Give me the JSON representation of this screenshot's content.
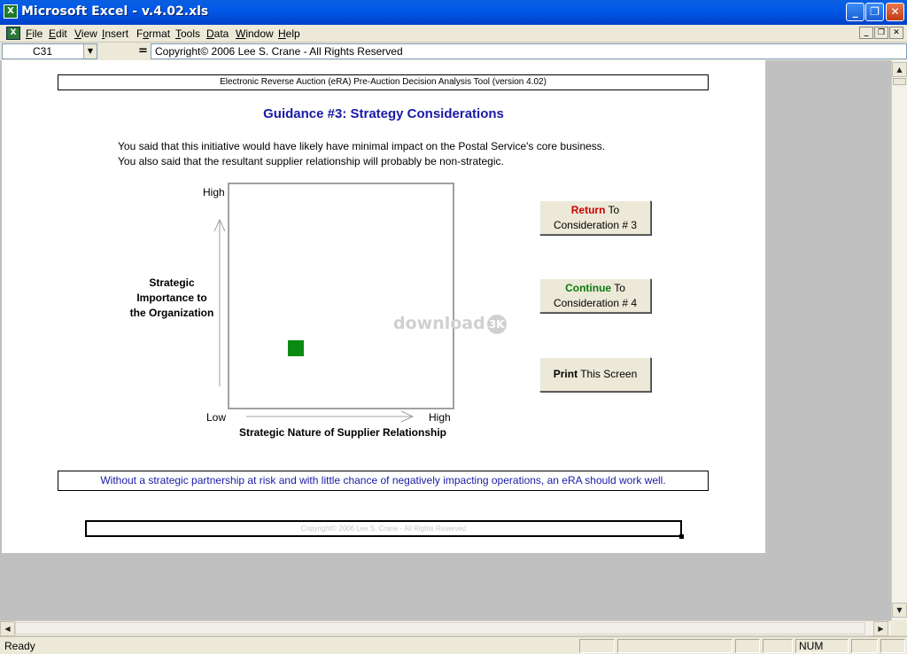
{
  "window": {
    "title": "Microsoft Excel - v.4.02.xls",
    "app_icon_glyph": "X",
    "controls": {
      "minimize": "_",
      "maximize": "❐",
      "close": "✕"
    }
  },
  "menu": {
    "doc_icon_glyph": "X",
    "items": [
      {
        "label": "File",
        "accel": "F",
        "rest": "ile"
      },
      {
        "label": "Edit",
        "accel": "E",
        "rest": "dit"
      },
      {
        "label": "View",
        "accel": "V",
        "rest": "iew"
      },
      {
        "label": "Insert",
        "accel": "I",
        "rest": "nsert"
      },
      {
        "label": "Format",
        "accel": "o",
        "pre": "F",
        "rest": "rmat"
      },
      {
        "label": "Tools",
        "accel": "T",
        "rest": "ools"
      },
      {
        "label": "Data",
        "accel": "D",
        "rest": "ata"
      },
      {
        "label": "Window",
        "accel": "W",
        "rest": "indow"
      },
      {
        "label": "Help",
        "accel": "H",
        "rest": "elp"
      }
    ],
    "doc_controls": {
      "minimize": "_",
      "restore": "❐",
      "close": "✕"
    }
  },
  "formula_bar": {
    "cell_ref": "C31",
    "dropdown_glyph": "▼",
    "equals": "=",
    "content": "Copyright© 2006  Lee S. Crane  -  All Rights Reserved"
  },
  "sheet": {
    "header": "Electronic Reverse Auction (eRA) Pre-Auction Decision Analysis Tool (version 4.02)",
    "title": "Guidance #3: Strategy Considerations",
    "statement_1": "You said that this initiative would have likely have minimal impact on the Postal Service's core business.",
    "statement_2": "You also said that the resultant supplier relationship will probably be non-strategic.",
    "matrix": {
      "y_high": "High",
      "x_low": "Low",
      "x_high": "High",
      "y_label_1": "Strategic",
      "y_label_2": "Importance to",
      "y_label_3": "the Organization",
      "x_label": "Strategic Nature of Supplier Relationship",
      "marker": {
        "x_fraction": 0.26,
        "y_fraction": 0.7,
        "color": "#0b8a12"
      }
    },
    "buttons": {
      "return": {
        "strong": "Return",
        "rest": " To",
        "line2": "Consideration # 3",
        "strong_color": "#cc0000"
      },
      "continue": {
        "strong": "Continue",
        "rest": " To",
        "line2": "Consideration # 4",
        "strong_color": "#0b7a0b"
      },
      "print": {
        "strong": "Print",
        "rest": " This Screen"
      }
    },
    "conclusion": "Without a strategic partnership at risk and with little chance of negatively impacting operations, an eRA should work well.",
    "footer_copyright": "Copyright© 2006  Lee S. Crane  -  All Rights Reserved",
    "watermark": "download",
    "watermark_badge": "3K"
  },
  "scroll": {
    "up": "▲",
    "down": "▼",
    "left": "◀",
    "right": "▶"
  },
  "status": {
    "text": "Ready",
    "num": "NUM"
  }
}
